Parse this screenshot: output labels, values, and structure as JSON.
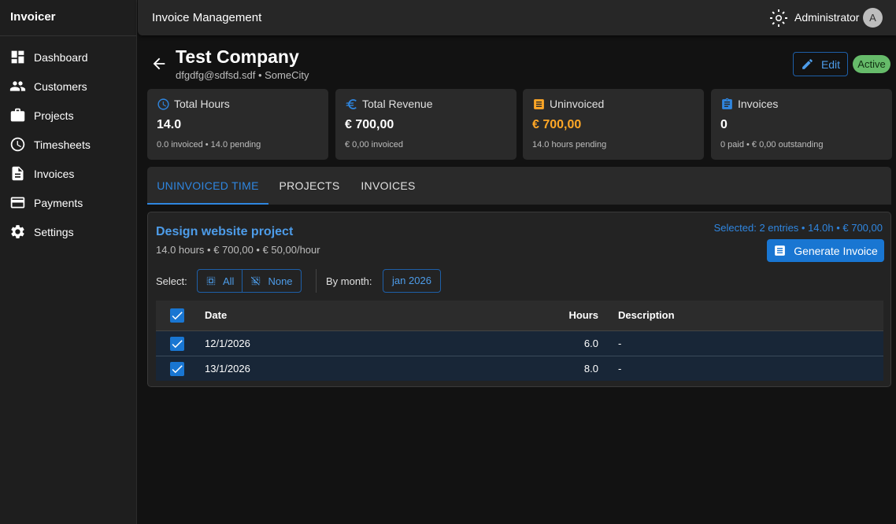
{
  "sidebar": {
    "brand": "Invoicer",
    "items": [
      {
        "label": "Dashboard",
        "icon": "dashboard-icon"
      },
      {
        "label": "Customers",
        "icon": "people-icon"
      },
      {
        "label": "Projects",
        "icon": "briefcase-icon"
      },
      {
        "label": "Timesheets",
        "icon": "clock-icon"
      },
      {
        "label": "Invoices",
        "icon": "document-icon"
      },
      {
        "label": "Payments",
        "icon": "credit-card-icon"
      },
      {
        "label": "Settings",
        "icon": "gear-icon"
      }
    ]
  },
  "topbar": {
    "title": "Invoice Management",
    "user": "Administrator",
    "avatar_initial": "A"
  },
  "customer": {
    "name": "Test Company",
    "subtitle": "dfgdfg@sdfsd.sdf • SomeCity",
    "edit_label": "Edit",
    "status": "Active"
  },
  "stats": [
    {
      "label": "Total Hours",
      "value": "14.0",
      "sub": "0.0 invoiced • 14.0 pending",
      "icon": "clock-icon"
    },
    {
      "label": "Total Revenue",
      "value": "€ 700,00",
      "sub": "€ 0,00 invoiced",
      "icon": "euro-icon"
    },
    {
      "label": "Uninvoiced",
      "value": "€ 700,00",
      "sub": "14.0 hours pending",
      "icon": "receipt-icon"
    },
    {
      "label": "Invoices",
      "value": "0",
      "sub": "0 paid • € 0,00 outstanding",
      "icon": "clipboard-icon"
    }
  ],
  "tabs": [
    {
      "label": "UNINVOICED TIME",
      "active": true
    },
    {
      "label": "PROJECTS",
      "active": false
    },
    {
      "label": "INVOICES",
      "active": false
    }
  ],
  "project": {
    "title": "Design website project",
    "subtitle": "14.0 hours • € 700,00 • € 50,00/hour",
    "selected_info": "Selected: 2 entries • 14.0h • € 700,00",
    "generate_label": "Generate Invoice"
  },
  "filters": {
    "select_label": "Select:",
    "all_label": "All",
    "none_label": "None",
    "month_label": "By month:",
    "month_value": "jan 2026"
  },
  "table": {
    "headers": {
      "date": "Date",
      "hours": "Hours",
      "description": "Description"
    },
    "rows": [
      {
        "date": "12/1/2026",
        "hours": "6.0",
        "description": "-",
        "checked": true
      },
      {
        "date": "13/1/2026",
        "hours": "8.0",
        "description": "-",
        "checked": true
      }
    ]
  },
  "colors": {
    "accent": "#2f86e0",
    "primary_button": "#1976d2",
    "warning": "#ffa726",
    "success": "#66bb6a",
    "background": "#121212",
    "surface": "#2a2a2a"
  }
}
